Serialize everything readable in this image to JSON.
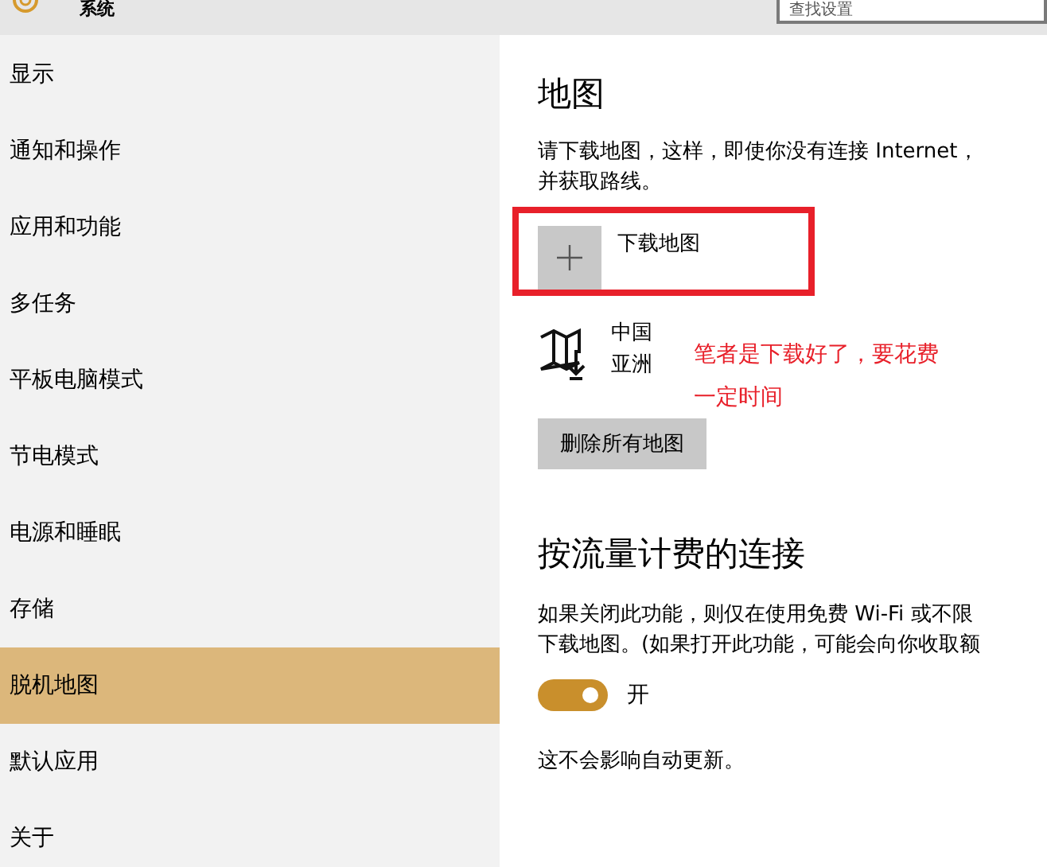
{
  "header": {
    "title": "系统",
    "search": {
      "placeholder": "查找设置"
    }
  },
  "sidebar": {
    "items": [
      {
        "label": "显示",
        "selected": false
      },
      {
        "label": "通知和操作",
        "selected": false
      },
      {
        "label": "应用和功能",
        "selected": false
      },
      {
        "label": "多任务",
        "selected": false
      },
      {
        "label": "平板电脑模式",
        "selected": false
      },
      {
        "label": "节电模式",
        "selected": false
      },
      {
        "label": "电源和睡眠",
        "selected": false
      },
      {
        "label": "存储",
        "selected": false
      },
      {
        "label": "脱机地图",
        "selected": true
      },
      {
        "label": "默认应用",
        "selected": false
      },
      {
        "label": "关于",
        "selected": false
      }
    ]
  },
  "maps": {
    "title": "地图",
    "description": [
      "请下载地图，这样，即使你没有连接 Internet，",
      "并获取路线。"
    ],
    "download_button": "下载地图",
    "downloaded": [
      {
        "name": "中国",
        "region": "亚洲"
      }
    ],
    "annotation": [
      "笔者是下载好了，要花费",
      "一定时间"
    ],
    "delete_button": "删除所有地图"
  },
  "metered": {
    "title": "按流量计费的连接",
    "description": [
      "如果关闭此功能，则仅在使用免费 Wi-Fi 或不限",
      "下载地图。(如果打开此功能，可能会向你收取额"
    ],
    "toggle": {
      "on": true,
      "label": "开"
    },
    "note": "这不会影响自动更新。"
  }
}
